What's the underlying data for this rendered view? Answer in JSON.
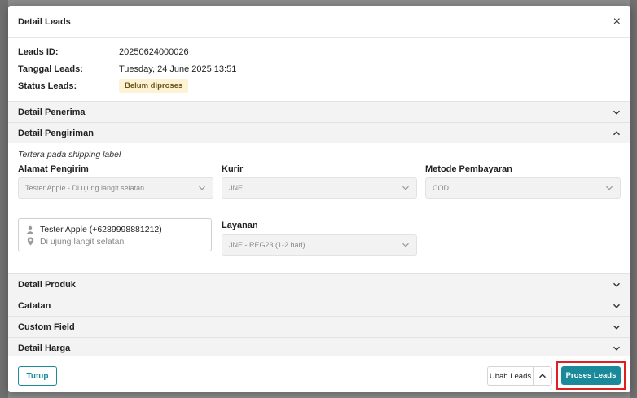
{
  "modal": {
    "title": "Detail Leads",
    "close_label": "×"
  },
  "info": {
    "leads_id_label": "Leads ID:",
    "leads_id_value": "20250624000026",
    "tanggal_label": "Tanggal Leads:",
    "tanggal_value": "Tuesday, 24 June 2025 13:51",
    "status_label": "Status Leads:",
    "status_value": "Belum diproses"
  },
  "sections": {
    "penerima": "Detail Penerima",
    "pengiriman": "Detail Pengiriman",
    "produk": "Detail Produk",
    "catatan": "Catatan",
    "custom_field": "Custom Field",
    "harga": "Detail Harga"
  },
  "shipping": {
    "note": "Tertera pada shipping label",
    "alamat_label": "Alamat Pengirim",
    "alamat_value": "Tester Apple - Di ujung langit selatan",
    "kurir_label": "Kurir",
    "kurir_value": "JNE",
    "metode_label": "Metode Pembayaran",
    "metode_value": "COD",
    "layanan_label": "Layanan",
    "layanan_value": "JNE - REG23 (1-2 hari)",
    "sender_name": "Tester Apple (+6289998881212)",
    "sender_address": "Di ujung langit selatan"
  },
  "footer": {
    "tutup": "Tutup",
    "ubah": "Ubah Leads",
    "proses": "Proses Leads"
  },
  "colors": {
    "accent": "#1a8a9a",
    "highlight": "#e02020",
    "badge_bg": "#fdf2d3"
  },
  "icons": [
    "close-icon",
    "chevron-down-icon",
    "chevron-up-icon",
    "person-icon",
    "location-pin-icon"
  ]
}
